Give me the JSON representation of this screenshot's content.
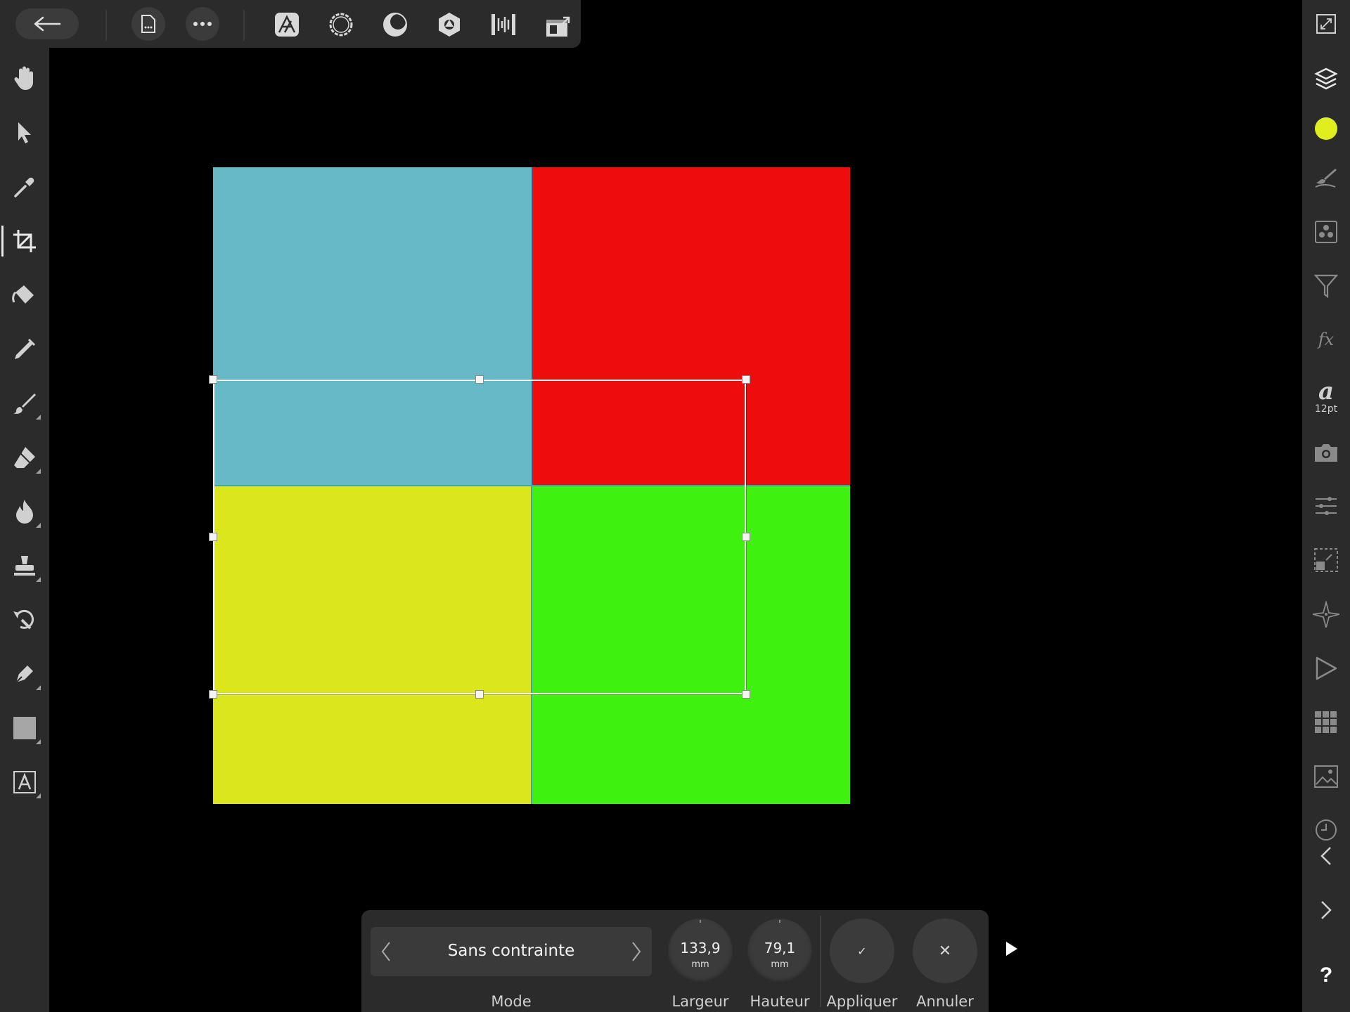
{
  "top_toolbar": {
    "tools": [
      "back",
      "document",
      "more",
      "photo-persona",
      "liquify-persona",
      "develop-persona",
      "tone-mapping-persona",
      "export-persona",
      "auto-arrange"
    ]
  },
  "left_toolbar": {
    "tools": [
      "hand",
      "move",
      "eyedropper",
      "crop",
      "flood-fill",
      "gradient",
      "paint-brush",
      "erase-brush",
      "dodge-burn",
      "clone",
      "undo-brush",
      "pen",
      "shape",
      "text"
    ],
    "active_tool": "crop"
  },
  "right_toolbar": {
    "tools": [
      "fullscreen",
      "layers",
      "color",
      "brushes",
      "channels",
      "adjustments",
      "effects",
      "text-style",
      "stock",
      "transform",
      "selection",
      "navigator",
      "macros",
      "snapping",
      "images",
      "history",
      "collapse-left",
      "collapse-right",
      "help"
    ],
    "font_size": "12pt",
    "color_swatch": "#e1ee1d",
    "help_label": "?"
  },
  "canvas": {
    "quadrant_colors": {
      "top_left": "#68b9c7",
      "top_right": "#ee0d0d",
      "bottom_left": "#dce61d",
      "bottom_right": "#3ef10f"
    }
  },
  "crop_bar": {
    "mode": {
      "value": "Sans contrainte",
      "label": "Mode"
    },
    "width": {
      "value": "133,9",
      "unit": "mm",
      "label": "Largeur"
    },
    "height": {
      "value": "79,1",
      "unit": "mm",
      "label": "Hauteur"
    },
    "apply": {
      "label": "Appliquer",
      "glyph": "✓"
    },
    "cancel": {
      "label": "Annuler",
      "glyph": "✕"
    }
  }
}
